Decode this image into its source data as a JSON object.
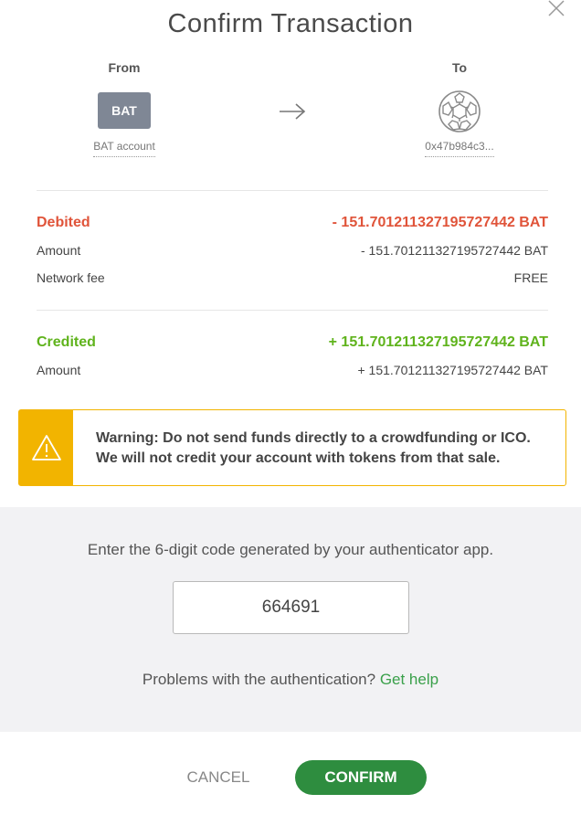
{
  "dialog": {
    "title": "Confirm Transaction"
  },
  "from": {
    "label": "From",
    "asset_badge": "BAT",
    "account": "BAT account"
  },
  "to": {
    "label": "To",
    "address": "0x47b984c3..."
  },
  "debited": {
    "label": "Debited",
    "total": "- 151.701211327195727442 BAT",
    "amount_label": "Amount",
    "amount": "- 151.701211327195727442 BAT",
    "fee_label": "Network fee",
    "fee": "FREE"
  },
  "credited": {
    "label": "Credited",
    "total": "+ 151.701211327195727442 BAT",
    "amount_label": "Amount",
    "amount": "+ 151.701211327195727442 BAT"
  },
  "warning": {
    "line1": "Warning: Do not send funds directly to a crowdfunding or ICO.",
    "line2": "We will not credit your account with tokens from that sale."
  },
  "auth": {
    "prompt": "Enter the 6-digit code generated by your authenticator app.",
    "code": "664691",
    "help_text": "Problems with the authentication?",
    "help_link": "Get help"
  },
  "buttons": {
    "cancel": "CANCEL",
    "confirm": "CONFIRM"
  },
  "colors": {
    "debit": "#e0543a",
    "credit": "#5fb31c",
    "warning": "#f2b400",
    "confirm": "#2e8d3f",
    "link": "#3aa04a"
  }
}
